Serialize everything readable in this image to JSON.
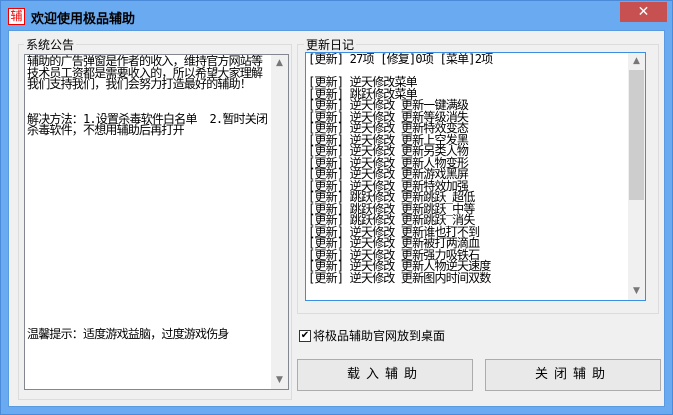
{
  "window": {
    "title": "欢迎使用极品辅助",
    "icon_char": "辅",
    "close_label": "✕"
  },
  "notice": {
    "label": "系统公告",
    "text": "辅助的广告弹窗是作者的收入，维持官方网站等技术员工资都是需要收入的，所以希望大家理解我们支持我们，我们会努力打造最好的辅助！\n\n\n解决方法：1.设置杀毒软件白名单  2.暂时关闭杀毒软件，不想用辅助后再打开",
    "tip": "温馨提示：适度游戏益脑，过度游戏伤身"
  },
  "changelog": {
    "label": "更新日记",
    "lines": [
      "[更新] 27项 [修复]0项 [菜单]2项",
      "",
      "[更新] 逆天修改菜单",
      "[更新] 跳跃修改菜单",
      "[更新] 逆天修改 更新一键满级",
      "[更新] 逆天修改 更新等级消失",
      "[更新] 逆天修改 更新特效变态",
      "[更新] 逆天修改 更新上空发黑",
      "[更新] 逆天修改 更新另类人物",
      "[更新] 逆天修改 更新人物变形",
      "[更新] 逆天修改 更新游戏黑屏",
      "[更新] 逆天修改 更新特效加强",
      "[更新] 跳跃修改 更新跳跃_超低",
      "[更新] 跳跃修改 更新跳跃_中等",
      "[更新] 跳跃修改 更新跳跃_消失",
      "[更新] 逆天修改 更新谁也打不到",
      "[更新] 逆天修改 更新被打两滴血",
      "[更新] 逆天修改 更新强力吸铁石",
      "[更新] 逆天修改 更新人物逆天速度",
      "[更新] 逆天修改 更新图内时间双数"
    ]
  },
  "checkbox": {
    "label": "将极品辅助官网放到桌面",
    "checked": true
  },
  "buttons": {
    "load": "载入辅助",
    "close": "关闭辅助"
  }
}
